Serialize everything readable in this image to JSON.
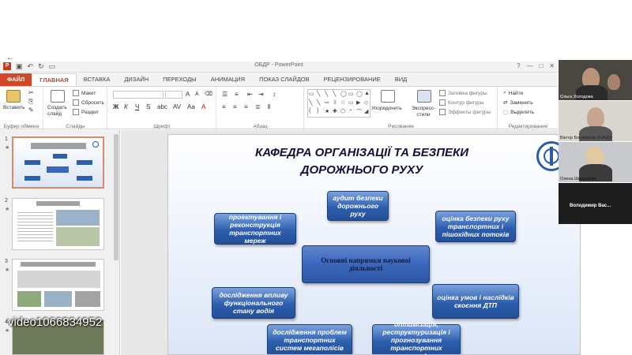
{
  "window": {
    "title": "ОБДР - PowerPoint",
    "window_buttons": [
      "?",
      "—",
      "□",
      "✕"
    ]
  },
  "ribbon_tabs": [
    "ФАЙЛ",
    "ГЛАВНАЯ",
    "ВСТАВКА",
    "ДИЗАЙН",
    "ПЕРЕХОДЫ",
    "АНИМАЦИЯ",
    "ПОКАЗ СЛАЙДОВ",
    "РЕЦЕНЗИРОВАНИЕ",
    "ВИД"
  ],
  "ribbon": {
    "clipboard": {
      "paste": "Вставить",
      "group": "Буфер обмена"
    },
    "slides": {
      "new_slide": "Создать слайд",
      "layout": "Макет",
      "reset": "Сбросить",
      "section": "Раздел",
      "group": "Слайды"
    },
    "font": {
      "group": "Шрифт"
    },
    "paragraph": {
      "group": "Абзац"
    },
    "drawing": {
      "arrange": "Упорядочить",
      "quick_styles": "Экспресс-стили",
      "fill": "Заливка фигуры",
      "outline": "Контур фигуры",
      "effects": "Эффекты фигуры",
      "group": "Рисование"
    },
    "editing": {
      "find": "Найти",
      "replace": "Заменить",
      "select": "Выделить",
      "group": "Редактирование"
    }
  },
  "slide_panel": {
    "numbers": [
      "1",
      "2",
      "3",
      "4"
    ],
    "star": "★"
  },
  "slide": {
    "title_line1": "КАФЕДРА ОРГАНІЗАЦІЇ ТА БЕЗПЕКИ",
    "title_line2": "ДОРОЖНЬОГО РУХУ",
    "center": "Основні напрямки наукової діяльності",
    "boxes": {
      "audit": "аудит безпеки дорожнього руху",
      "design": "проектування і реконструкція транспортних мереж",
      "assessment": "оцінка безпеки руху транспортних і пішохідних потоків",
      "research": "дослідження впливу функціонального стану водія",
      "conditions": "оцінка умов і наслідків скоєння ДТП",
      "megacities": "дослідження проблем транспортних систем мегаполісів",
      "optimization": "оптимізація, реструктуризація і прогнозування транспортних потоків"
    }
  },
  "participants": [
    "Ольга Холодова",
    "Віктор Богомолов ХНАДУ",
    "Олена Шершнєва",
    "Володимир Вас..."
  ],
  "overlay_text": "video1066834952",
  "colors": {
    "file_tab": "#d24726",
    "accent": "#b7472a",
    "box_blue": "#2d5fae"
  }
}
